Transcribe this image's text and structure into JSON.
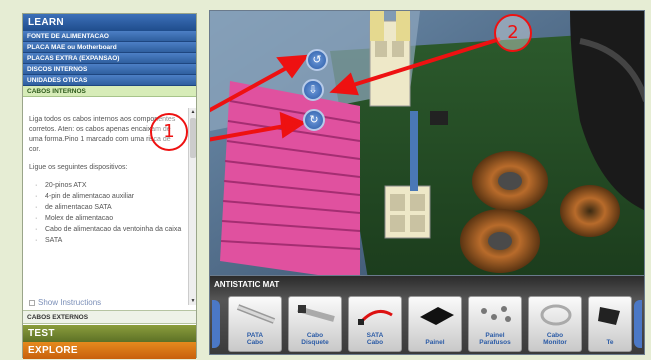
{
  "sidebar": {
    "learn_label": "LEARN",
    "items": [
      "FONTE DE ALIMENTACAO",
      "PLACA MAE ou Motherboard",
      "PLACAS EXTRA (EXPANSAO)",
      "DISCOS INTERNOS",
      "UNIDADES OTICAS",
      "CABOS INTERNOS"
    ],
    "instructions": {
      "p1": "Liga todos os cabos internos aos componentes corretos. Aten: os cabos apenas encaixam de uma forma.Pino 1 marcado com uma risca de cor.",
      "p2": "Ligue os seguintes dispositivos:",
      "list": [
        "20-pinos ATX",
        "4-pin de alimentacao auxiliar",
        "de alimentacao SATA",
        "Molex de alimentacao",
        "Cabo de alimentacao da ventoinha da caixa",
        "SATA"
      ]
    },
    "show_instructions": "Show Instructions",
    "cabos_externos": "CABOS EXTERNOS",
    "test_label": "TEST",
    "explore_label": "EXPLORE"
  },
  "annotations": {
    "one": "1",
    "two": "2"
  },
  "tray": {
    "label": "ANTISTATIC MAT",
    "tiles": [
      {
        "line1": "PATA",
        "line2": "Cabo"
      },
      {
        "line1": "Cabo",
        "line2": "Disquete"
      },
      {
        "line1": "SATA",
        "line2": "Cabo"
      },
      {
        "line1": "",
        "line2": "Painel"
      },
      {
        "line1": "Painel",
        "line2": "Parafusos"
      },
      {
        "line1": "Cabo",
        "line2": "Monitor"
      },
      {
        "line1": "",
        "line2": "Te"
      }
    ]
  },
  "colors": {
    "learn": "#2f5f9f",
    "test": "#6f8230",
    "explore": "#d9761a",
    "annotation": "#ee1111",
    "heatsink": "#e0519f"
  }
}
